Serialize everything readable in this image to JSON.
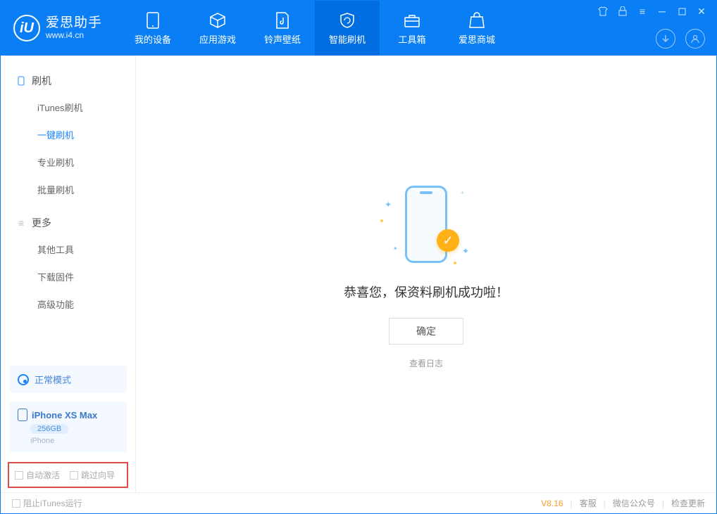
{
  "app": {
    "title": "爱思助手",
    "subtitle": "www.i4.cn"
  },
  "nav": {
    "items": [
      {
        "label": "我的设备"
      },
      {
        "label": "应用游戏"
      },
      {
        "label": "铃声壁纸"
      },
      {
        "label": "智能刷机"
      },
      {
        "label": "工具箱"
      },
      {
        "label": "爱思商城"
      }
    ]
  },
  "sidebar": {
    "group1": {
      "title": "刷机",
      "items": [
        "iTunes刷机",
        "一键刷机",
        "专业刷机",
        "批量刷机"
      ]
    },
    "group2": {
      "title": "更多",
      "items": [
        "其他工具",
        "下载固件",
        "高级功能"
      ]
    },
    "mode": "正常模式",
    "device": {
      "name": "iPhone XS Max",
      "capacity": "256GB",
      "type": "iPhone"
    },
    "checks": {
      "auto_activate": "自动激活",
      "skip_guide": "跳过向导"
    }
  },
  "main": {
    "success": "恭喜您，保资料刷机成功啦！",
    "ok": "确定",
    "view_log": "查看日志"
  },
  "footer": {
    "block_itunes": "阻止iTunes运行",
    "version": "V8.16",
    "support": "客服",
    "wechat": "微信公众号",
    "check_update": "检查更新"
  }
}
